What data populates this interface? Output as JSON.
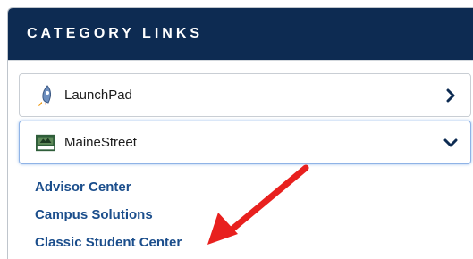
{
  "panel": {
    "header_title": "CATEGORY LINKS"
  },
  "items": [
    {
      "label": "LaunchPad",
      "icon": "rocket-icon",
      "state": "collapsed"
    },
    {
      "label": "MaineStreet",
      "icon": "mainestreet-logo-icon",
      "state": "expanded"
    }
  ],
  "sublinks": [
    {
      "label": "Advisor Center"
    },
    {
      "label": "Campus Solutions"
    },
    {
      "label": "Classic Student Center"
    }
  ],
  "colors": {
    "header_bg": "#0d2b52",
    "link": "#1b4e8c",
    "annotation_arrow": "#e8201e"
  }
}
